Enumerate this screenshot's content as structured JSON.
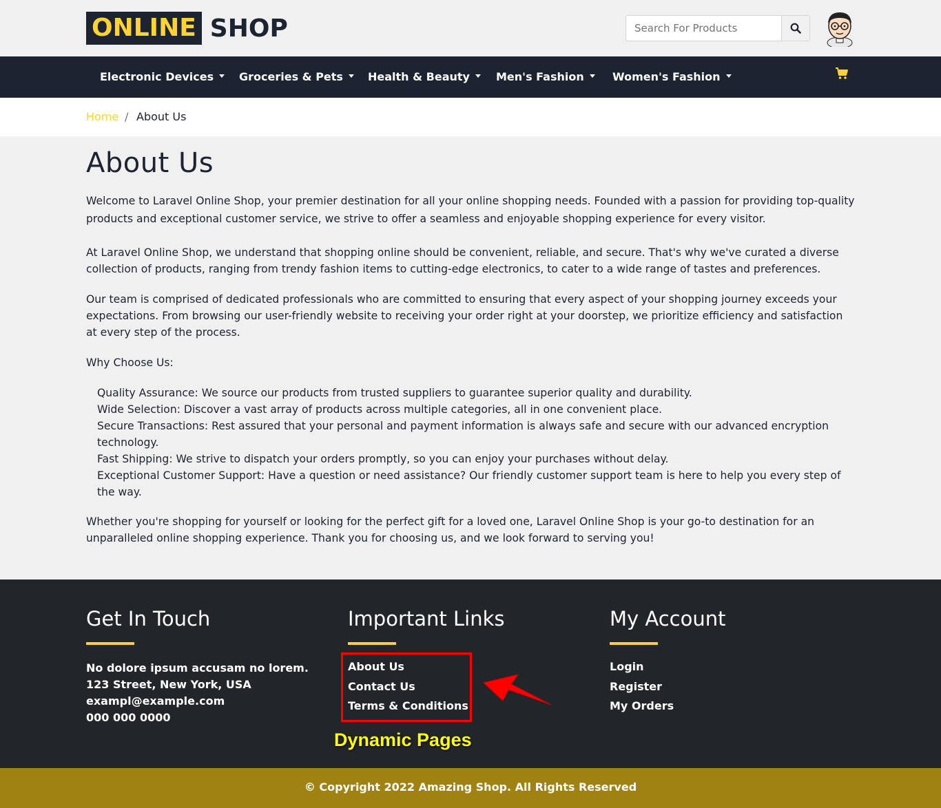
{
  "brand": {
    "part1": "ONLINE",
    "part2": "SHOP"
  },
  "search": {
    "placeholder": "Search For Products"
  },
  "nav": {
    "items": [
      {
        "label": "Electronic Devices"
      },
      {
        "label": "Groceries & Pets"
      },
      {
        "label": "Health & Beauty"
      },
      {
        "label": "Men's Fashion"
      },
      {
        "label": "Women's Fashion"
      }
    ]
  },
  "breadcrumb": {
    "home": "Home",
    "separator": "/",
    "current": "About Us"
  },
  "page": {
    "title": "About Us",
    "p1": "Welcome to Laravel Online Shop, your premier destination for all your online shopping needs. Founded with a passion for providing top-quality products and exceptional customer service, we strive to offer a seamless and enjoyable shopping experience for every visitor.",
    "p2": "At Laravel Online Shop, we understand that shopping online should be convenient, reliable, and secure. That's why we've curated a diverse collection of products, ranging from trendy fashion items to cutting-edge electronics, to cater to a wide range of tastes and preferences.",
    "p3": "Our team is comprised of dedicated professionals who are committed to ensuring that every aspect of your shopping journey exceeds your expectations. From browsing our user-friendly website to receiving your order right at your doorstep, we prioritize efficiency and satisfaction at every step of the process.",
    "p4": "Why Choose Us:",
    "list": [
      "Quality Assurance: We source our products from trusted suppliers to guarantee superior quality and durability.",
      "Wide Selection: Discover a vast array of products across multiple categories, all in one convenient place.",
      "Secure Transactions: Rest assured that your personal and payment information is always safe and secure with our advanced encryption technology.",
      "Fast Shipping: We strive to dispatch your orders promptly, so you can enjoy your purchases without delay.",
      "Exceptional Customer Support: Have a question or need assistance? Our friendly customer support team is here to help you every step of the way."
    ],
    "p5": "Whether you're shopping for yourself or looking for the perfect gift for a loved one, Laravel Online Shop is your go-to destination for an unparalleled online shopping experience. Thank you for choosing us, and we look forward to serving you!"
  },
  "footer": {
    "touch": {
      "title": "Get In Touch",
      "lines": [
        "No dolore ipsum accusam no lorem.",
        "123 Street, New York, USA",
        "exampl@example.com",
        "000 000 0000"
      ]
    },
    "links": {
      "title": "Important Links",
      "items": [
        "About Us",
        "Contact Us",
        "Terms & Conditions"
      ]
    },
    "account": {
      "title": "My Account",
      "items": [
        "Login",
        "Register",
        "My Orders"
      ]
    },
    "annotation": "Dynamic Pages",
    "copyright": "© Copyright 2022 Amazing Shop. All Rights Reserved"
  },
  "colors": {
    "accent": "#ffd333",
    "dark": "#1c2331",
    "footer_bg": "#22252a",
    "copyright_bg": "#a08213",
    "annotation_red": "#ff0000",
    "annotation_yellow": "#ffff00"
  }
}
